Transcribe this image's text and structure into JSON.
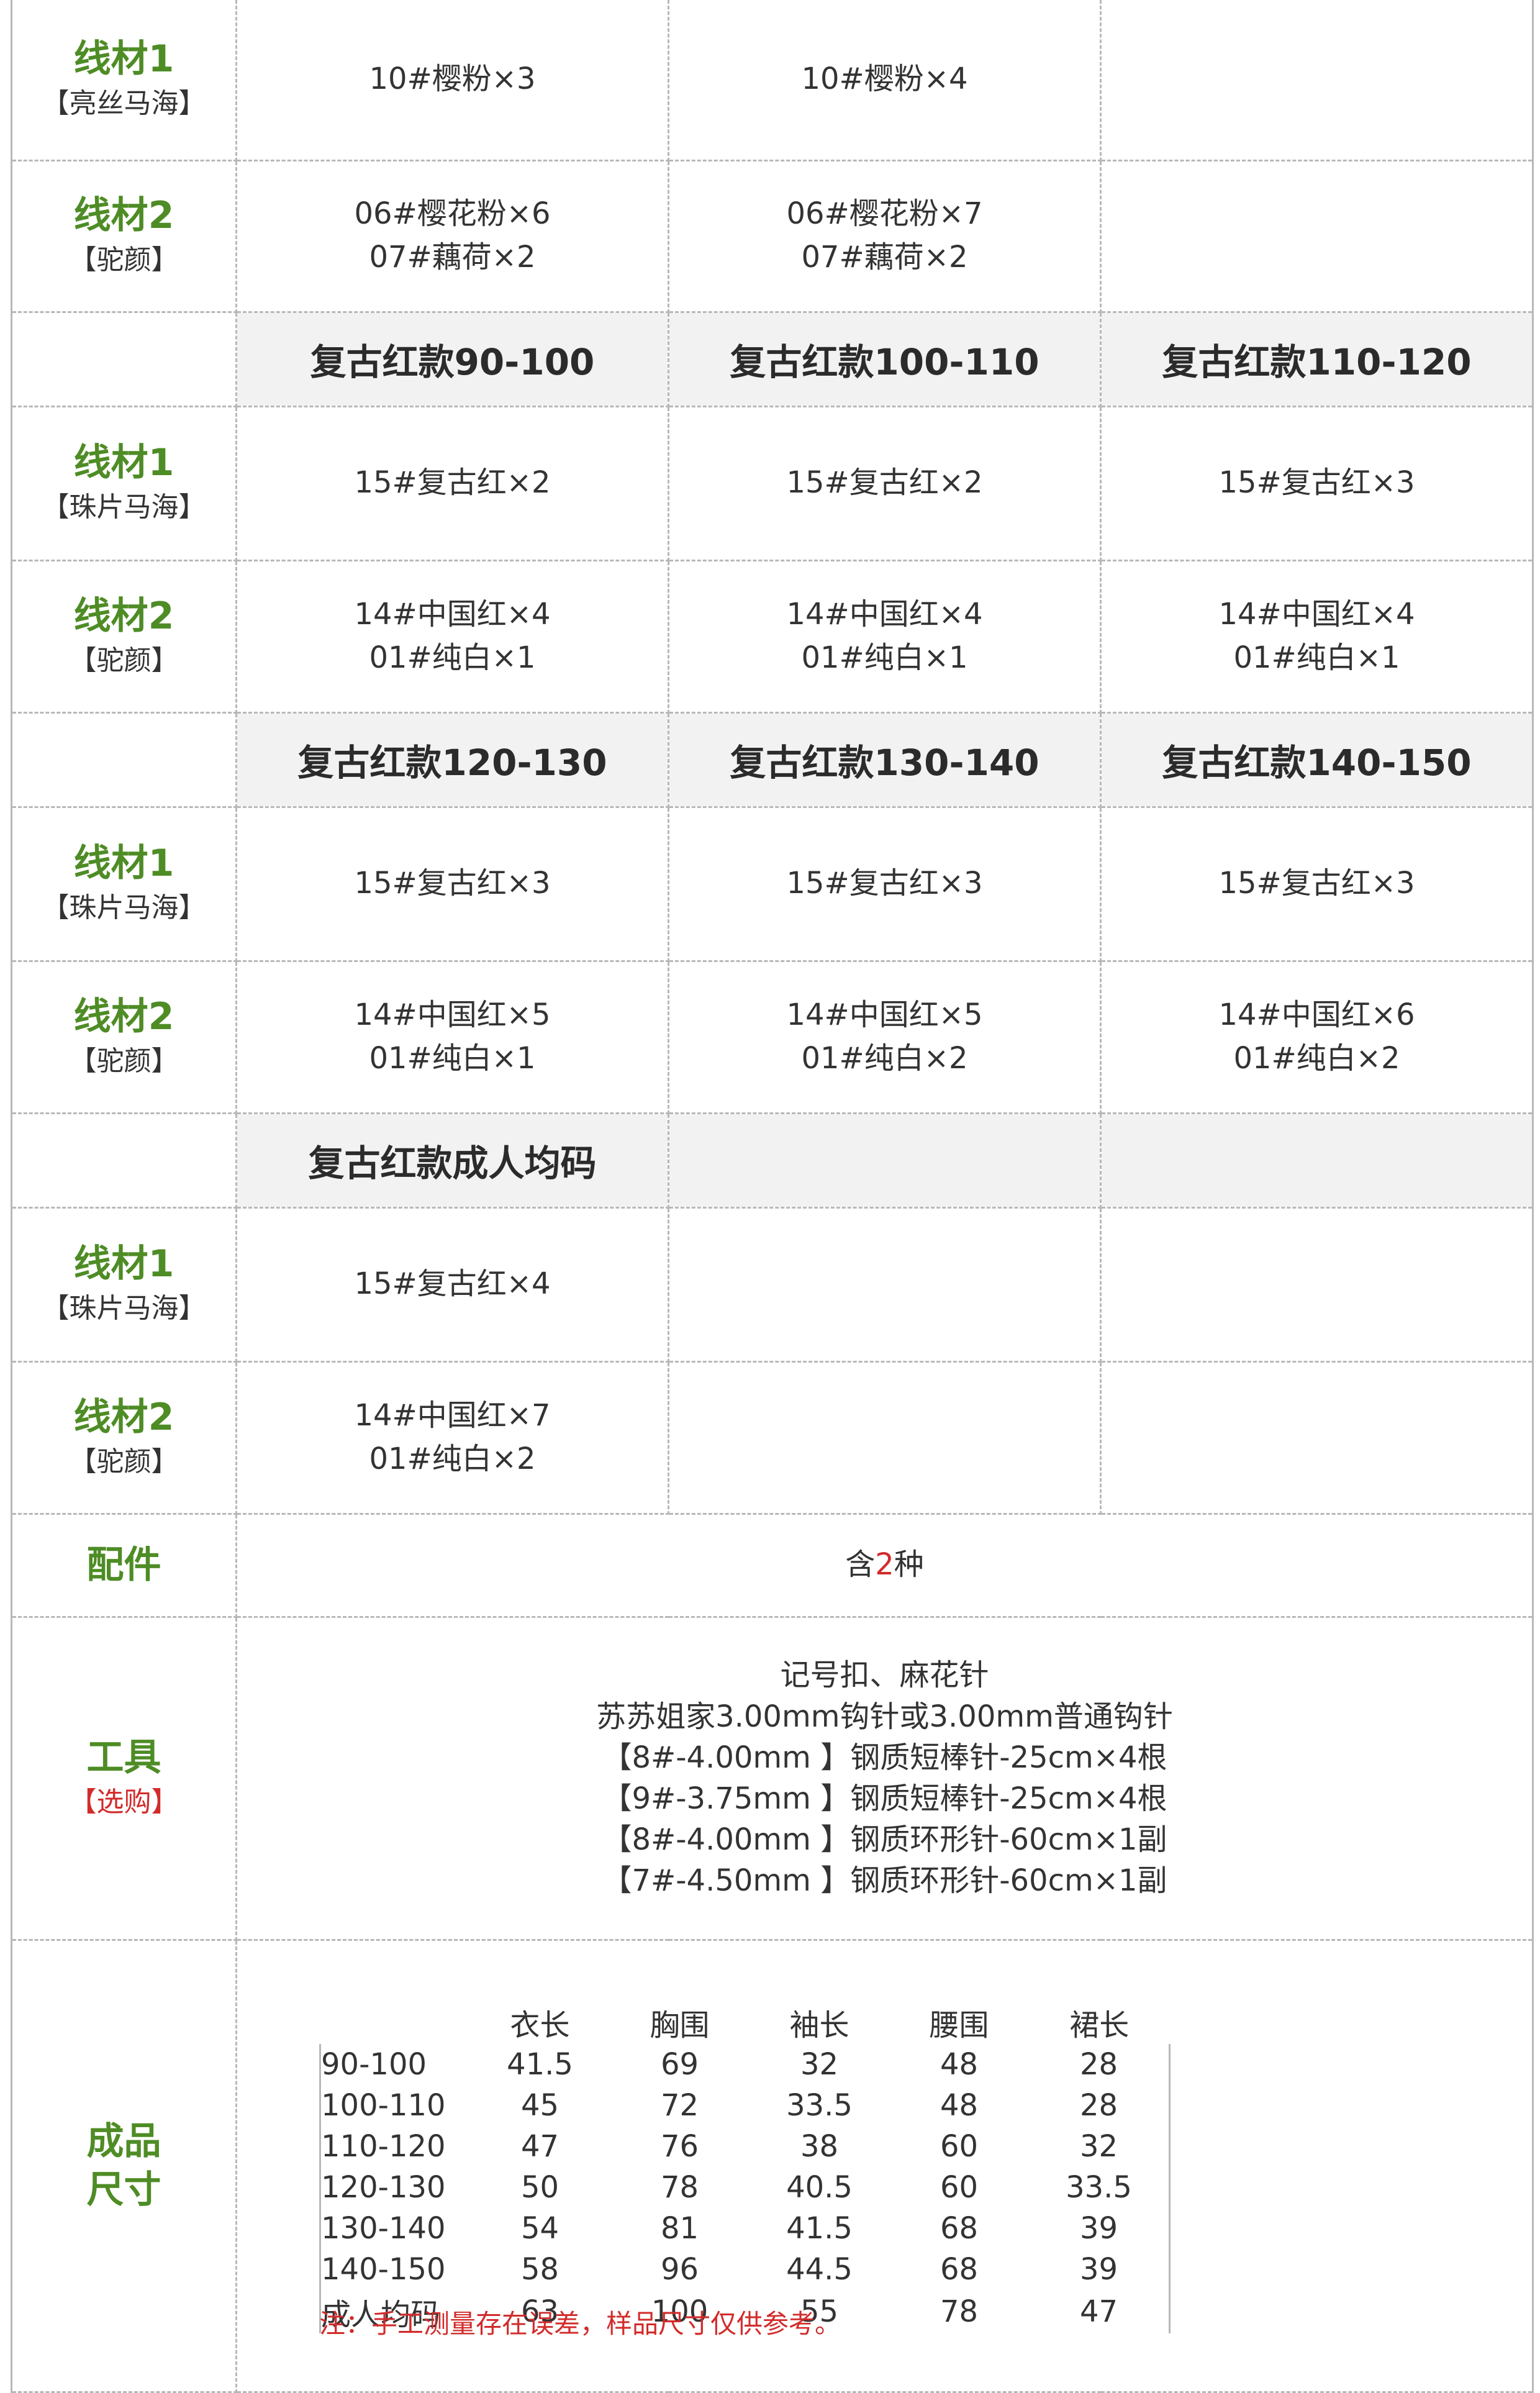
{
  "rows": [
    {
      "kind": "yarn",
      "label": "线材1",
      "sub": "【亮丝马海】",
      "cells": [
        [
          "10#樱粉×3"
        ],
        [
          "10#樱粉×4"
        ],
        []
      ]
    },
    {
      "kind": "yarn",
      "label": "线材2",
      "sub": "【驼颜】",
      "cells": [
        [
          "06#樱花粉×6",
          "07#藕荷×2"
        ],
        [
          "06#樱花粉×7",
          "07#藕荷×2"
        ],
        []
      ]
    },
    {
      "kind": "head",
      "cells": [
        "复古红款90-100",
        "复古红款100-110",
        "复古红款110-120"
      ]
    },
    {
      "kind": "yarn",
      "label": "线材1",
      "sub": "【珠片马海】",
      "cells": [
        [
          "15#复古红×2"
        ],
        [
          "15#复古红×2"
        ],
        [
          "15#复古红×3"
        ]
      ]
    },
    {
      "kind": "yarn",
      "label": "线材2",
      "sub": "【驼颜】",
      "cells": [
        [
          "14#中国红×4",
          "01#纯白×1"
        ],
        [
          "14#中国红×4",
          "01#纯白×1"
        ],
        [
          "14#中国红×4",
          "01#纯白×1"
        ]
      ]
    },
    {
      "kind": "head",
      "cells": [
        "复古红款120-130",
        "复古红款130-140",
        "复古红款140-150"
      ]
    },
    {
      "kind": "yarn",
      "label": "线材1",
      "sub": "【珠片马海】",
      "cells": [
        [
          "15#复古红×3"
        ],
        [
          "15#复古红×3"
        ],
        [
          "15#复古红×3"
        ]
      ]
    },
    {
      "kind": "yarn",
      "label": "线材2",
      "sub": "【驼颜】",
      "cells": [
        [
          "14#中国红×5",
          "01#纯白×1"
        ],
        [
          "14#中国红×5",
          "01#纯白×2"
        ],
        [
          "14#中国红×6",
          "01#纯白×2"
        ]
      ]
    },
    {
      "kind": "head",
      "cells": [
        "复古红款成人均码",
        "",
        ""
      ]
    },
    {
      "kind": "yarn",
      "label": "线材1",
      "sub": "【珠片马海】",
      "cells": [
        [
          "15#复古红×4"
        ],
        [],
        []
      ]
    },
    {
      "kind": "yarn",
      "label": "线材2",
      "sub": "【驼颜】",
      "cells": [
        [
          "14#中国红×7",
          "01#纯白×2"
        ],
        [],
        []
      ]
    }
  ],
  "accessories": {
    "label": "配件",
    "text_before": "含",
    "count": "2",
    "text_after": "种"
  },
  "tools": {
    "label": "工具",
    "sub": "【选购】",
    "lines": [
      "记号扣、麻花针",
      "苏苏姐家3.00mm钩针或3.00mm普通钩针",
      "【8#-4.00mm 】钢质短棒针-25cm×4根",
      "【9#-3.75mm 】钢质短棒针-25cm×4根",
      "【8#-4.00mm 】钢质环形针-60cm×1副",
      "【7#-4.50mm 】钢质环形针-60cm×1副"
    ]
  },
  "sizes": {
    "label_line1": "成品",
    "label_line2": "尺寸",
    "columns": [
      "衣长",
      "胸围",
      "袖长",
      "腰围",
      "裙长"
    ],
    "rows": [
      {
        "name": "90-100",
        "values": [
          "41.5",
          "69",
          "32",
          "48",
          "28"
        ]
      },
      {
        "name": "100-110",
        "values": [
          "45",
          "72",
          "33.5",
          "48",
          "28"
        ]
      },
      {
        "name": "110-120",
        "values": [
          "47",
          "76",
          "38",
          "60",
          "32"
        ]
      },
      {
        "name": "120-130",
        "values": [
          "50",
          "78",
          "40.5",
          "60",
          "33.5"
        ]
      },
      {
        "name": "130-140",
        "values": [
          "54",
          "81",
          "41.5",
          "68",
          "39"
        ]
      },
      {
        "name": "140-150",
        "values": [
          "58",
          "96",
          "44.5",
          "68",
          "39"
        ]
      },
      {
        "name": "成人均码",
        "values": [
          "63",
          "100",
          "55",
          "78",
          "47"
        ]
      }
    ],
    "note": "注：手工测量存在误差，样品尺寸仅供参考。"
  }
}
